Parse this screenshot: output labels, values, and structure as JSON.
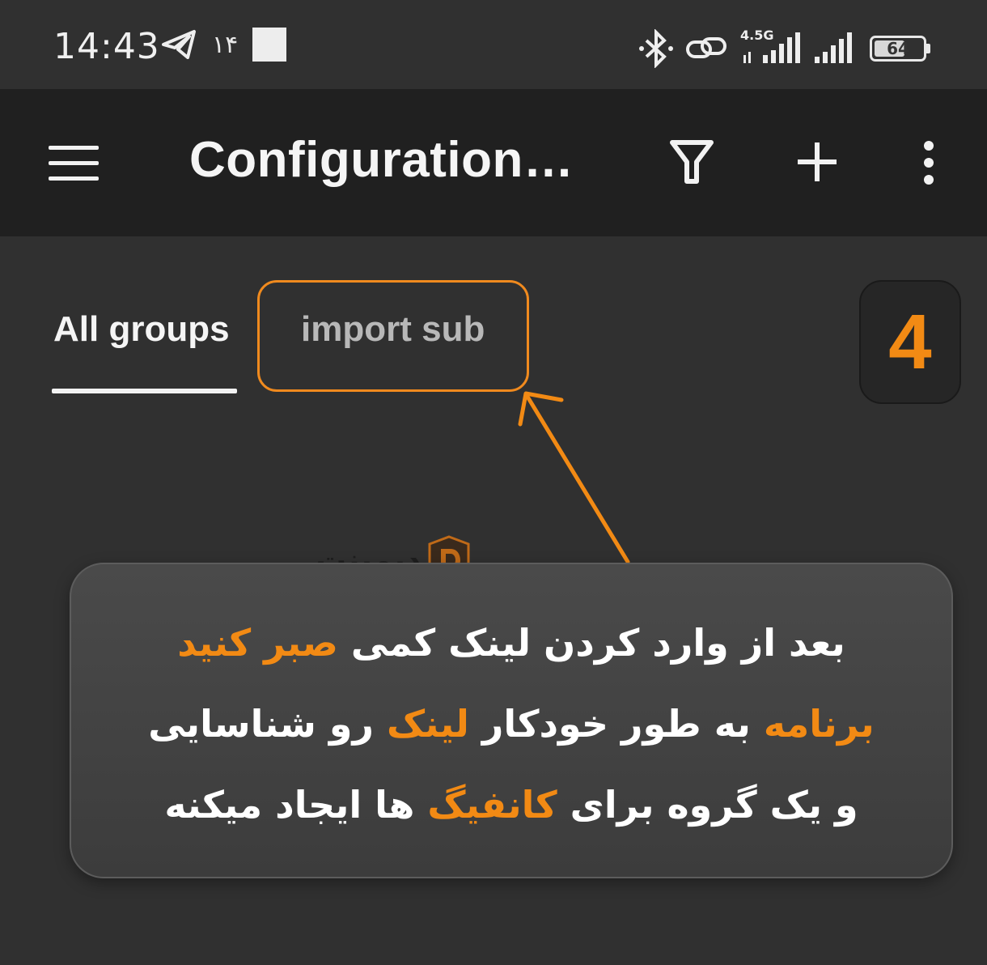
{
  "status_bar": {
    "time": "14:43",
    "notification_count": "۱۴",
    "network_type": "4.5G",
    "battery": "64",
    "battery_level_percent": 64,
    "icons": [
      "telegram-icon",
      "square-notification-icon",
      "bluetooth-icon",
      "link-icon",
      "signal-icon",
      "signal-icon"
    ]
  },
  "app_bar": {
    "title": "Configuration…",
    "actions": [
      "filter-icon",
      "plus-icon",
      "more-vert-icon"
    ]
  },
  "tabs": [
    {
      "label": "All groups",
      "selected": true
    },
    {
      "label": "import sub",
      "selected": false
    }
  ],
  "step_badge": "4",
  "watermark": {
    "text": "دیمینت"
  },
  "callout": {
    "line1": {
      "part1": "بعد از وارد کردن لینک کمی ",
      "highlight": "صبر کنید"
    },
    "line2": {
      "highlight1": "برنامه",
      "part1": " به طور خودکار ",
      "highlight2": "لینک",
      "part2": " رو شناسایی"
    },
    "line3": {
      "part1": "و یک گروه برای ",
      "highlight": "کانفیگ",
      "part2": " ها ایجاد میکنه"
    }
  },
  "colors": {
    "accent": "#f28a14",
    "background": "#303030",
    "app_bar": "#202020"
  }
}
